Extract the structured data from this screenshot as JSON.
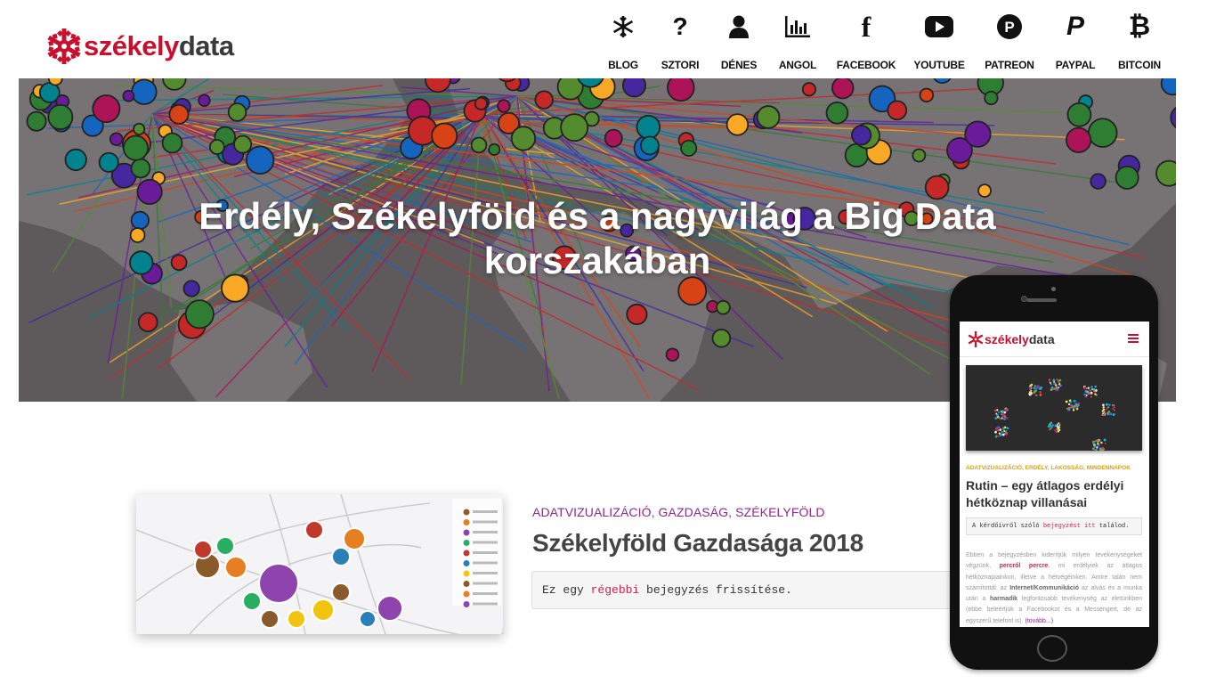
{
  "site": {
    "logo_part1": "székely",
    "logo_part2": "data"
  },
  "nav": [
    {
      "label": "BLOG",
      "icon": "snowflake-icon"
    },
    {
      "label": "SZTORI",
      "icon": "question-icon"
    },
    {
      "label": "DÉNES",
      "icon": "user-icon"
    },
    {
      "label": "ANGOL",
      "icon": "bar-chart-icon"
    },
    {
      "label": "FACEBOOK",
      "icon": "facebook-icon"
    },
    {
      "label": "YOUTUBE",
      "icon": "youtube-icon"
    },
    {
      "label": "PATREON",
      "icon": "patreon-icon"
    },
    {
      "label": "PAYPAL",
      "icon": "paypal-icon"
    },
    {
      "label": "BITCOIN",
      "icon": "bitcoin-icon"
    }
  ],
  "hero": {
    "title": "Erdély, Székelyföld és a nagyvilág a Big Data korszakában"
  },
  "post": {
    "categories": "ADATVIZUALIZÁCIÓ, GAZDASÁG, SZÉKELYFÖLD",
    "title": "Székelyföld Gazdasága 2018",
    "excerpt_pre": "Ez egy ",
    "excerpt_link": "régebbi",
    "excerpt_post": " bejegyzés frissítése."
  },
  "mobile": {
    "logo_part1": "székely",
    "logo_part2": "data",
    "categories": "ADATVIZUALIZÁCIÓ, ERDÉLY, LAKOSSÁG, MINDENNAPOK",
    "title": "Rutin – egy átlagos erdélyi hétköznap villanásai",
    "code_pre": "A kérdőívről szóló ",
    "code_link": "bejegyzést itt",
    "code_post": " találod.",
    "body_1": "Ebben a bejegyzésben kiderítjük milyen tevékenységeket végzünk, ",
    "body_b1": "percről percre",
    "body_2": ", mi erdélyiek az átlagos hétköznapjainkon, illetve a hétvégéinken. Amire talán nem számítottál: az ",
    "body_b2": "Internet/Kommunikáció",
    "body_3": " az alvás és a munka után a ",
    "body_b3": "harmadik",
    "body_4": " legfontosabb tevékenység az életünkben (ebbe beleértjük a Facebookot és a Messengert, de az egyszerű telefont is). ",
    "body_more": "(tovább...)"
  },
  "colors": {
    "brand_red": "#c8102e",
    "category_purple": "#8e2a8b",
    "mobile_category": "#d4a017",
    "code_pink": "#c7254e"
  }
}
